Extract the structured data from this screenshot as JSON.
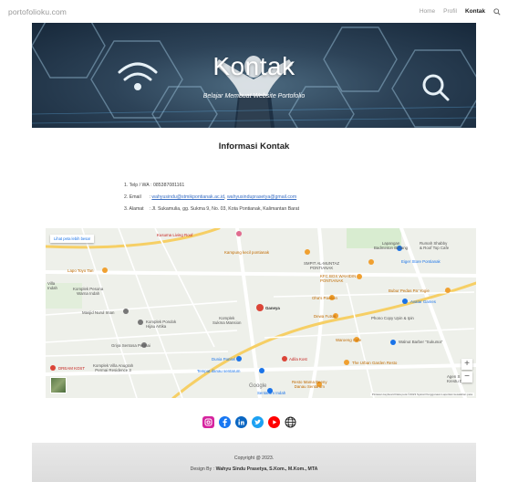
{
  "navbar": {
    "brand": "portofolioku.com",
    "items": [
      {
        "label": "Home"
      },
      {
        "label": "Profil"
      },
      {
        "label": "Kontak"
      }
    ],
    "search_icon": "search-icon"
  },
  "hero": {
    "title": "Kontak",
    "subtitle": "Belajar Membuat Website Portofolio"
  },
  "contact": {
    "heading": "Informasi Kontak",
    "phone_label": "1. Telp / WA",
    "phone_value": ": 085387081161",
    "email_label": "2. Email",
    "email_sep": ":",
    "email_1": "wahyusindu@stmikpontianak.ac.id",
    "email_comma": ",",
    "email_2": "wahyusinduprasetya@gmail.com",
    "address_label": "3. Alamat",
    "address_value": ": Jl. Sukamulia, gg. Sukma 9, No. 03, Kota Pontianak, Kalimantan Barat"
  },
  "map": {
    "view_larger": "Lihat peta lebih besar",
    "labels": {
      "kusuma": "Kusuma Living Roof",
      "kampung": "Kampung kecil pontianak",
      "lapangan": "Lapangan\nBadminton Bintang",
      "rumah_shabby": "Rumah Shabby\n& Roof Top Cafe",
      "smpit": "SMPIT AL-MUNTAZ\nPONTIANAK",
      "kfc": "KFC BOX WAHIDIN\nPONTIANAK",
      "eiger": "Eiger Store Pontianak",
      "lapo": "Lapo Toyo Tan",
      "villa": "Villa\nIndah",
      "komplek_pesona": "Komplek Pesona\nWarna Indah",
      "bubur": "Bubur Pedas Pa' Yogie",
      "ohas": "Oha's Pavilion",
      "avatar": "Avatar Games",
      "masjid": "Masjid Nurul Iman",
      "pondok": "Komplek Pondok\nHijau Artika",
      "sukma": "Komplek\nSukma Mansion",
      "ganeya": "Ganeya",
      "dewa": "Dewa Futsal",
      "phono": "Phono Copy Upin & Ipin",
      "griya": "Griya Sentosa Permai",
      "waroeng": "Waroeng Cafe",
      "walnut": "Walnut Barber \"Sukuma\"",
      "dunia": "Dunia Ponsel",
      "adila": "Adila Kost",
      "urban": "The Urban Garden Resto",
      "dream": "DREAM KOST",
      "komplek_villa": "Komplek Villa Anugrah\nPermai Residence 3",
      "tempat": "Tempat danau sentarum",
      "resto": "Resto Mama Beeny\nDanau Sentarum",
      "agen": "Agen S\nKrestu Dr. S",
      "google": "Google",
      "sentarum": "Sentarum Indah"
    },
    "attribution": "Pintasan keyboard   Data peta ©2023   Syarat Penggunaan   Laporkan kesalahan peta"
  },
  "social": [
    {
      "icon": "instagram-icon",
      "color": "#d6249f"
    },
    {
      "icon": "facebook-icon",
      "color": "#1877f2"
    },
    {
      "icon": "linkedin-icon",
      "color": "#0a66c2"
    },
    {
      "icon": "twitter-icon",
      "color": "#1da1f2"
    },
    {
      "icon": "youtube-icon",
      "color": "#ff0000"
    },
    {
      "icon": "globe-icon",
      "color": "#222222"
    }
  ],
  "footer": {
    "copyright": "Copyright @ 2023.",
    "design_prefix": "Design By :",
    "design_name": "Wahyu Sindu Prasetya, S.Kom., M.Kom., MTA"
  }
}
